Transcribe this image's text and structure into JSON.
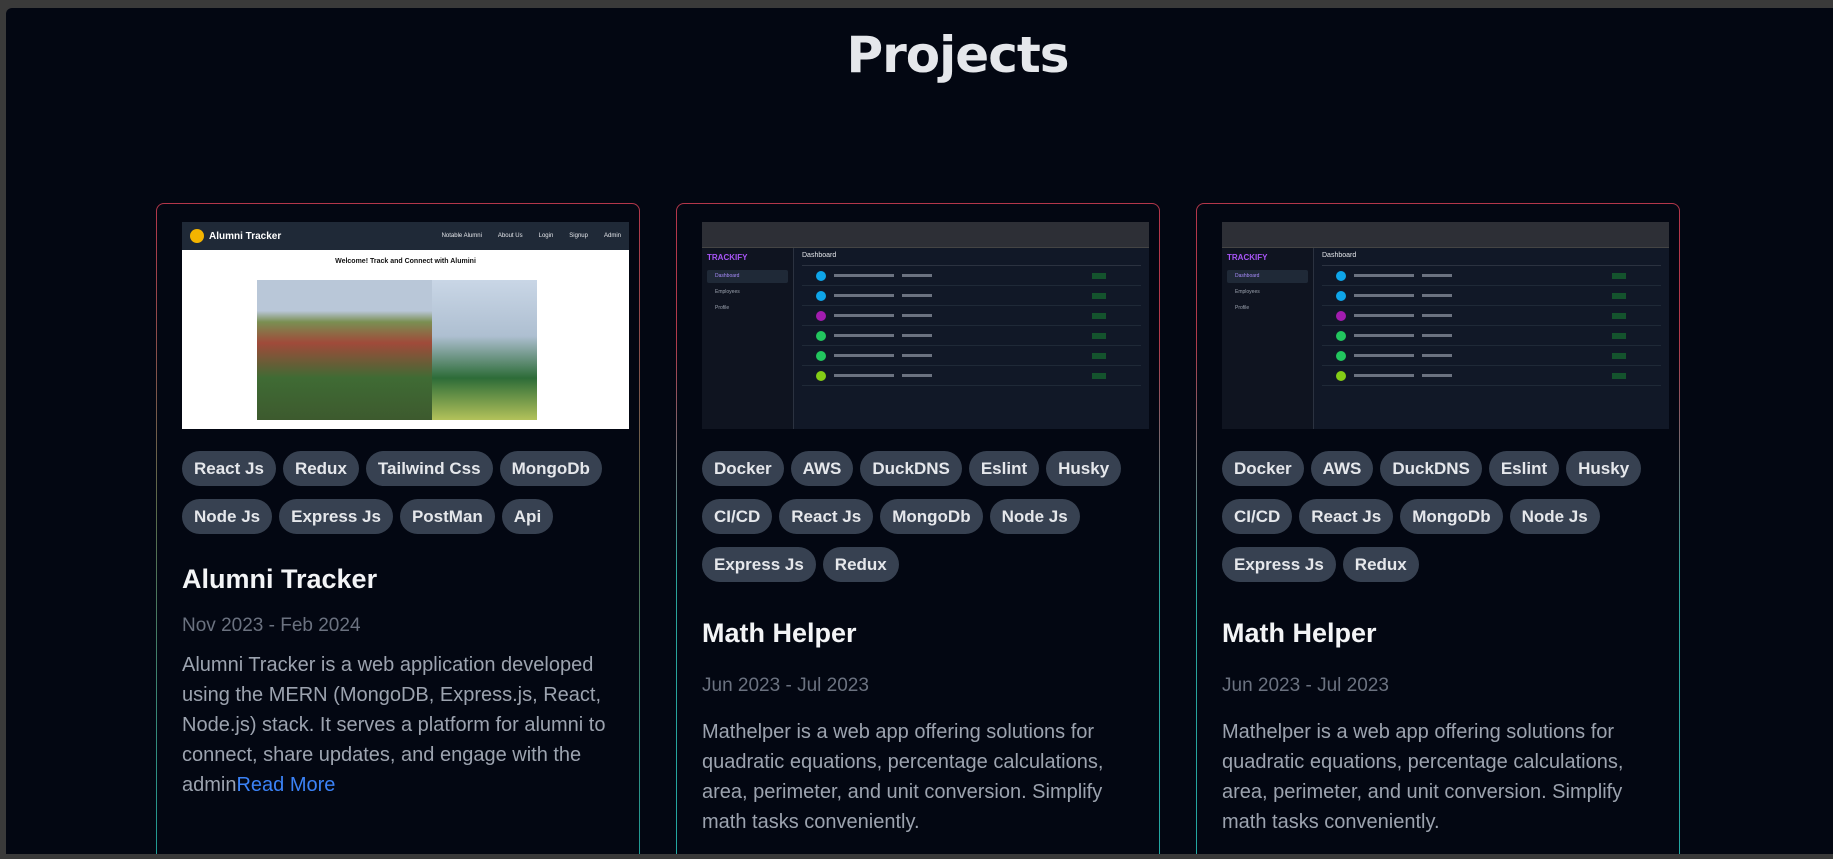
{
  "page": {
    "title": "Projects"
  },
  "projects": [
    {
      "title": "Alumni Tracker",
      "dates": "Nov 2023 - Feb 2024",
      "description": "Alumni Tracker is a web application developed using the MERN (MongoDB, Express.js, React, Node.js) stack. It serves a platform for alumni to connect, share updates, and engage with the admin",
      "read_more": "Read More",
      "tags": [
        "React Js",
        "Redux",
        "Tailwind Css",
        "MongoDb",
        "Node Js",
        "Express Js",
        "PostMan",
        "Api"
      ],
      "screenshot": {
        "brand": "Alumni Tracker",
        "nav": [
          "Notable Alumni",
          "About Us",
          "Login",
          "Signup",
          "Admin"
        ],
        "welcome": "Welcome! Track and Connect with Alumini"
      }
    },
    {
      "title": "Math Helper",
      "dates": "Jun 2023 - Jul 2023",
      "description": "Mathelper is a web app offering solutions for quadratic equations, percentage calculations, area, perimeter, and unit conversion. Simplify math tasks conveniently.",
      "tags": [
        "Docker",
        "AWS",
        "DuckDNS",
        "Eslint",
        "Husky",
        "CI/CD",
        "React Js",
        "MongoDb",
        "Node Js",
        "Express Js",
        "Redux"
      ],
      "screenshot": {
        "brand": "TRACKIFY",
        "header": "Dashboard",
        "sidebar": [
          "Dashboard",
          "Employees",
          "Profile"
        ]
      }
    },
    {
      "title": "Math Helper",
      "dates": "Jun 2023 - Jul 2023",
      "description": "Mathelper is a web app offering solutions for quadratic equations, percentage calculations, area, perimeter, and unit conversion. Simplify math tasks conveniently.",
      "tags": [
        "Docker",
        "AWS",
        "DuckDNS",
        "Eslint",
        "Husky",
        "CI/CD",
        "React Js",
        "MongoDb",
        "Node Js",
        "Express Js",
        "Redux"
      ],
      "screenshot": {
        "brand": "TRACKIFY",
        "header": "Dashboard",
        "sidebar": [
          "Dashboard",
          "Employees",
          "Profile"
        ]
      }
    }
  ],
  "colors": {
    "background": "#030712",
    "tag_bg": "#374151",
    "link": "#3b82f6"
  }
}
